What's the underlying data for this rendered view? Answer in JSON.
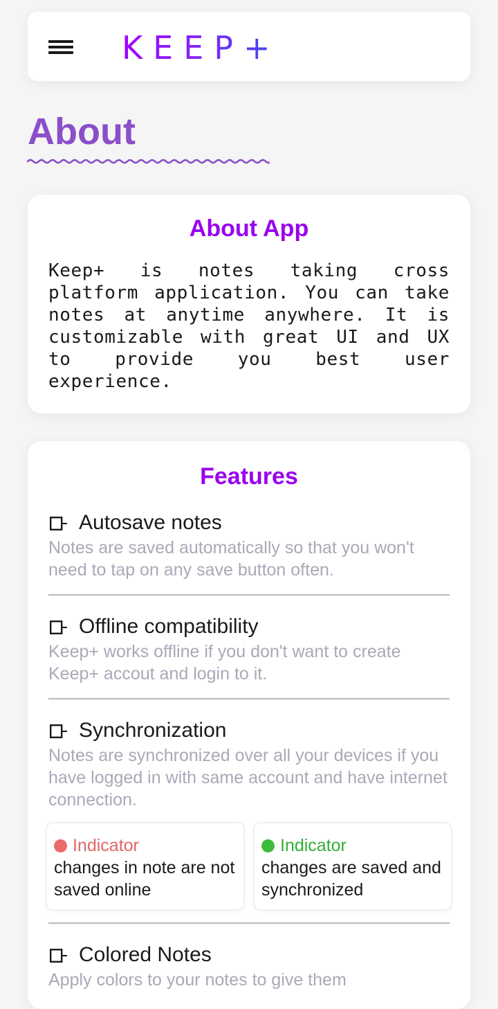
{
  "header": {
    "menu_icon": "hamburger-menu-icon",
    "logo": "KEEP+"
  },
  "page": {
    "title": "About"
  },
  "about_card": {
    "title": "About App",
    "text": "Keep+ is notes taking cross platform application. You can take notes at anytime anywhere. It is customizable with great UI and UX to provide you best user experience."
  },
  "features": {
    "title": "Features",
    "feature_icon": "checkbox-arrow-icon",
    "items": [
      {
        "title": "Autosave notes",
        "description": "Notes are saved automatically so that you won't need to tap on any save button often."
      },
      {
        "title": "Offline compatibility",
        "description": "Keep+ works offline if you don't want to create Keep+ accout and login to it."
      },
      {
        "title": "Synchronization",
        "description": "Notes are synchronized over all your devices if you have logged in with same account and have internet connection."
      },
      {
        "title": "Colored Notes",
        "description": "Apply colors to your notes to give them"
      }
    ],
    "indicators": [
      {
        "label": "Indicator",
        "color": "#ea6a6a",
        "text": "changes in note are not saved online"
      },
      {
        "label": "Indicator",
        "color": "#3dbb3d",
        "text": "changes are saved and synchronized"
      }
    ]
  },
  "colors": {
    "title_purple": "#8a4fc9",
    "accent_purple": "#9900ef",
    "logo_gradient_start": "#a100ff",
    "logo_gradient_end": "#3a48f0"
  }
}
